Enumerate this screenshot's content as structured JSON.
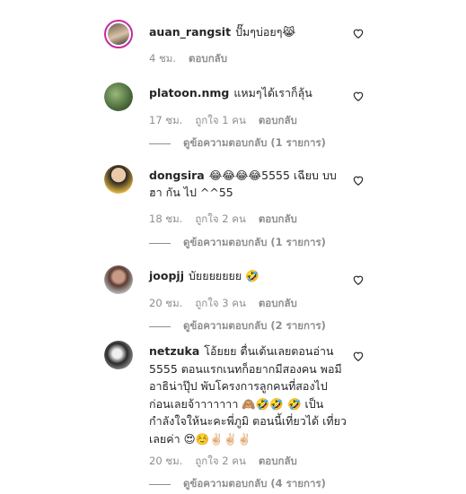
{
  "comments": [
    {
      "username": "auan_rangsit",
      "text": "ปั๊มๆบ่อยๆ😹",
      "time": "4 ชม.",
      "likes": "",
      "reply_label": "ตอบกลับ",
      "view_replies": ""
    },
    {
      "username": "platoon.nmg",
      "text": "แหมๆได้เราก็ลุ้น",
      "time": "17 ชม.",
      "likes": "ถูกใจ 1 คน",
      "reply_label": "ตอบกลับ",
      "view_replies": "ดูข้อความตอบกลับ (1 รายการ)"
    },
    {
      "username": "dongsira",
      "text": "😂😂😂😂5555 เฉียบ บบ ฮา กัน ไป ^^55",
      "time": "18 ชม.",
      "likes": "ถูกใจ 2 คน",
      "reply_label": "ตอบกลับ",
      "view_replies": "ดูข้อความตอบกลับ (1 รายการ)"
    },
    {
      "username": "joopjj",
      "text": "บัยยยยยยย 🤣",
      "time": "20 ชม.",
      "likes": "ถูกใจ 3 คน",
      "reply_label": "ตอบกลับ",
      "view_replies": "ดูข้อความตอบกลับ (2 รายการ)"
    },
    {
      "username": "netzuka",
      "text": "โอ้ยยย ตื่นเต้นเลยตอนอ่าน 5555 ตอนแรกเนทก็อยากมีสองคน พอมีอาธิน่าปุ๊ป พับโครงการลูกคนที่สองไปก่อนเลยจ้าาาาาาา 🙈🤣🤣 🤣 เป็นกำลังใจให้นะคะพี่ภูมิ ตอนนี้เที่ยวได้ เที่ยวเลยค่า 😍☺️✌🏻✌🏻✌🏻",
      "time": "20 ชม.",
      "likes": "ถูกใจ 2 คน",
      "reply_label": "ตอบกลับ",
      "view_replies": "ดูข้อความตอบกลับ (4 รายการ)"
    }
  ],
  "icons": {
    "like": "heart-outline-icon"
  },
  "colors": {
    "meta": "#8e8e8e",
    "story_ring": "#c32aa3",
    "text": "#262626"
  }
}
